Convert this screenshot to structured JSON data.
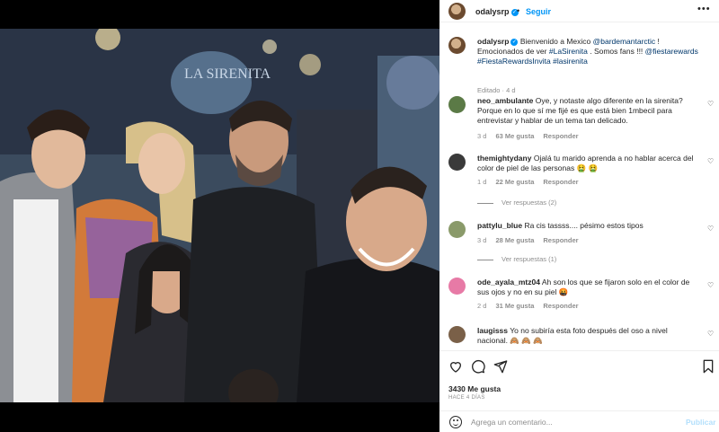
{
  "header": {
    "username": "odalysrp",
    "separator": "•",
    "follow_label": "Seguir",
    "more_icon": "more-options-icon"
  },
  "caption": {
    "username": "odalysrp",
    "text_parts": [
      "Bienvenido a Mexico ",
      "@bardemantarctic",
      " ! Emocionados de ver ",
      "#LaSirenita",
      " . Somos fans !!! ",
      "@fiestarewards",
      " ",
      "#FiestaRewardsInvita",
      " ",
      "#lasirenita"
    ],
    "meta": "Editado · 4 d"
  },
  "comments": [
    {
      "username": "neo_ambulante",
      "text": "Oye, y notaste algo diferente en la sirenita? Porque en lo que sí me fijé es que está bien 1mbecil para entrevistar y hablar de un tema tan delicado.",
      "time": "3 d",
      "likes": "63 Me gusta",
      "reply": "Responder",
      "avatar_color": "#5b7a46"
    },
    {
      "username": "themightydany",
      "text": "Ojalá tu marido aprenda a no hablar acerca del color de piel de las personas 🤮 🤮",
      "time": "1 d",
      "likes": "22 Me gusta",
      "reply": "Responder",
      "view_replies": "Ver respuestas (2)",
      "avatar_color": "#3a3a3a"
    },
    {
      "username": "pattylu_blue",
      "text": "Ra cis tassss.... pésimo estos tipos",
      "time": "3 d",
      "likes": "28 Me gusta",
      "reply": "Responder",
      "view_replies": "Ver respuestas (1)",
      "avatar_color": "#8a9a6a"
    },
    {
      "username": "ode_ayala_mtz04",
      "text": "Ah son los que se fijaron solo en el color de sus ojos y no en su piel 🤬",
      "time": "2 d",
      "likes": "31 Me gusta",
      "reply": "Responder",
      "avatar_color": "#e77aa6"
    },
    {
      "username": "laugisss",
      "text": "Yo no subiría esta foto después del oso a nivel nacional. 🙈 🙈 🙈",
      "avatar_color": "#7a6048"
    }
  ],
  "actions": {
    "like_icon": "heart-icon",
    "comment_icon": "comment-icon",
    "share_icon": "share-icon",
    "save_icon": "bookmark-icon",
    "likes_count": "3430 Me gusta",
    "time_ago": "HACE 4 DÍAS"
  },
  "add_comment": {
    "placeholder": "Agrega un comentario...",
    "post_label": "Publicar",
    "emoji_icon": "emoji-icon"
  },
  "photo": {
    "background_sign": "LA SIRENITA"
  },
  "colors": {
    "accent": "#0095f6",
    "link": "#00376b",
    "muted": "#8e8e8e",
    "post_disabled": "#b2dffc"
  }
}
